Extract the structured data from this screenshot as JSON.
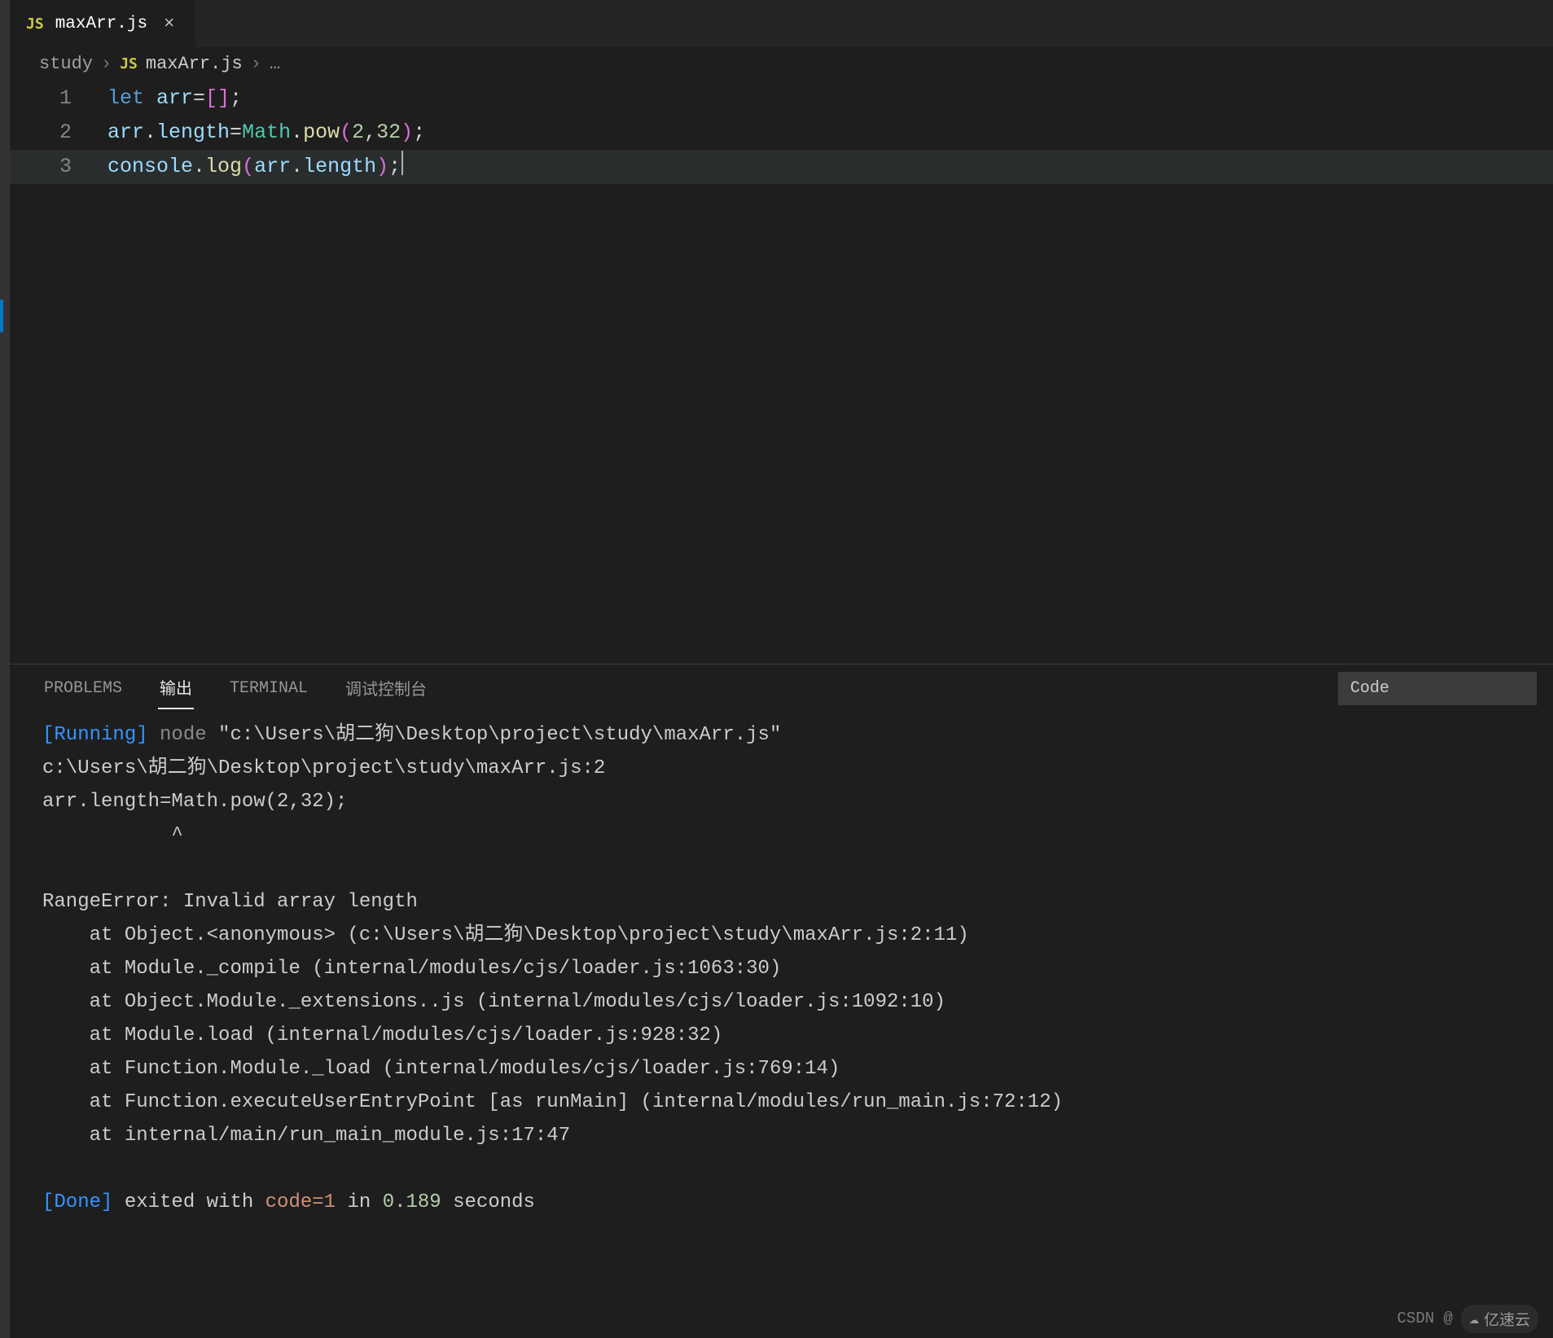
{
  "tab": {
    "icon_label": "JS",
    "filename": "maxArr.js",
    "close_glyph": "×"
  },
  "breadcrumbs": {
    "folder": "study",
    "sep": "›",
    "icon_label": "JS",
    "file": "maxArr.js",
    "trail": "…"
  },
  "editor": {
    "lines": [
      {
        "num": "1",
        "tokens": [
          {
            "t": "let ",
            "c": "tk-kw"
          },
          {
            "t": "arr",
            "c": "tk-var"
          },
          {
            "t": "=",
            "c": "tk-p"
          },
          {
            "t": "[",
            "c": "tk-br"
          },
          {
            "t": "]",
            "c": "tk-br"
          },
          {
            "t": ";",
            "c": "tk-p"
          }
        ]
      },
      {
        "num": "2",
        "tokens": [
          {
            "t": "arr",
            "c": "tk-var"
          },
          {
            "t": ".",
            "c": "tk-p"
          },
          {
            "t": "length",
            "c": "tk-prop"
          },
          {
            "t": "=",
            "c": "tk-p"
          },
          {
            "t": "Math",
            "c": "tk-obj"
          },
          {
            "t": ".",
            "c": "tk-p"
          },
          {
            "t": "pow",
            "c": "tk-fn"
          },
          {
            "t": "(",
            "c": "tk-br"
          },
          {
            "t": "2",
            "c": "tk-num"
          },
          {
            "t": ",",
            "c": "tk-p"
          },
          {
            "t": "32",
            "c": "tk-num"
          },
          {
            "t": ")",
            "c": "tk-br"
          },
          {
            "t": ";",
            "c": "tk-p"
          }
        ]
      },
      {
        "num": "3",
        "current": true,
        "cursor": true,
        "tokens": [
          {
            "t": "console",
            "c": "tk-var"
          },
          {
            "t": ".",
            "c": "tk-p"
          },
          {
            "t": "log",
            "c": "tk-fn"
          },
          {
            "t": "(",
            "c": "tk-br"
          },
          {
            "t": "arr",
            "c": "tk-var"
          },
          {
            "t": ".",
            "c": "tk-p"
          },
          {
            "t": "length",
            "c": "tk-prop"
          },
          {
            "t": ")",
            "c": "tk-br"
          },
          {
            "t": ";",
            "c": "tk-p"
          }
        ]
      }
    ]
  },
  "panel": {
    "tabs": {
      "problems": "PROBLEMS",
      "output": "输出",
      "terminal": "TERMINAL",
      "debug": "调试控制台"
    },
    "dropdown": "Code",
    "output_lines": [
      [
        {
          "t": "[Running]",
          "c": "t-bracket"
        },
        {
          "t": " ",
          "c": ""
        },
        {
          "t": "node",
          "c": "t-cmd"
        },
        {
          "t": " \"c:\\Users\\胡二狗\\Desktop\\project\\study\\maxArr.js\"",
          "c": ""
        }
      ],
      [
        {
          "t": "c:\\Users\\胡二狗\\Desktop\\project\\study\\maxArr.js:2",
          "c": ""
        }
      ],
      [
        {
          "t": "arr.length=Math.pow(2,32);",
          "c": ""
        }
      ],
      [
        {
          "t": "           ^",
          "c": ""
        }
      ],
      [
        {
          "t": "",
          "c": ""
        }
      ],
      [
        {
          "t": "RangeError: Invalid array length",
          "c": ""
        }
      ],
      [
        {
          "t": "    at Object.<anonymous> (c:\\Users\\胡二狗\\Desktop\\project\\study\\maxArr.js:2:11)",
          "c": ""
        }
      ],
      [
        {
          "t": "    at Module._compile (internal/modules/cjs/loader.js:1063:30)",
          "c": ""
        }
      ],
      [
        {
          "t": "    at Object.Module._extensions..js (internal/modules/cjs/loader.js:1092:10)",
          "c": ""
        }
      ],
      [
        {
          "t": "    at Module.load (internal/modules/cjs/loader.js:928:32)",
          "c": ""
        }
      ],
      [
        {
          "t": "    at Function.Module._load (internal/modules/cjs/loader.js:769:14)",
          "c": ""
        }
      ],
      [
        {
          "t": "    at Function.executeUserEntryPoint [as runMain] (internal/modules/run_main.js:72:12)",
          "c": ""
        }
      ],
      [
        {
          "t": "    at internal/main/run_main_module.js:17:47",
          "c": ""
        }
      ],
      [
        {
          "t": "",
          "c": ""
        }
      ],
      [
        {
          "t": "[Done]",
          "c": "t-bracket"
        },
        {
          "t": " exited with ",
          "c": ""
        },
        {
          "t": "code=1",
          "c": "t-code"
        },
        {
          "t": " in ",
          "c": ""
        },
        {
          "t": "0.189",
          "c": "t-time"
        },
        {
          "t": " seconds",
          "c": ""
        }
      ]
    ]
  },
  "footer": {
    "csdn": "CSDN @",
    "logo": "亿速云"
  }
}
